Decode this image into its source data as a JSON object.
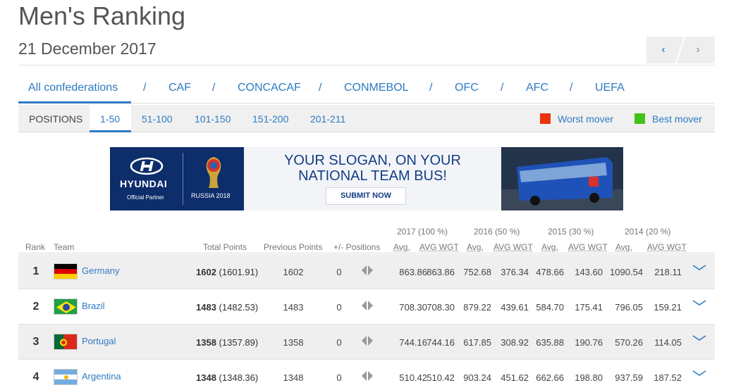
{
  "header": {
    "title": "Men's Ranking",
    "date": "21 December 2017",
    "prev_label": "‹",
    "next_label": "›"
  },
  "confederations": [
    "All confederations",
    "CAF",
    "CONCACAF",
    "CONMEBOL",
    "OFC",
    "AFC",
    "UEFA"
  ],
  "separator": "/",
  "positions": {
    "label": "POSITIONS",
    "ranges": [
      "1-50",
      "51-100",
      "101-150",
      "151-200",
      "201-211"
    ],
    "active": "1-50"
  },
  "legend": {
    "worst_label": "Worst mover",
    "best_label": "Best mover",
    "worst_color": "#e8350d",
    "best_color": "#44c21a"
  },
  "banner": {
    "brand": "HYUNDAI",
    "partner": "Official Partner",
    "event": "RUSSIA 2018",
    "slogan_line1": "YOUR SLOGAN, ON YOUR",
    "slogan_line2": "NATIONAL TEAM BUS!",
    "cta": "SUBMIT NOW"
  },
  "table": {
    "years": [
      "2017 (100 %)",
      "2016 (50 %)",
      "2015 (30 %)",
      "2014 (20 %)"
    ],
    "headers": {
      "rank": "Rank",
      "team": "Team",
      "total": "Total Points",
      "previous": "Previous Points",
      "movement": "+/- Positions",
      "avg": "Avg.",
      "avg_wgt": "AVG WGT"
    },
    "rows": [
      {
        "rank": "1",
        "team": "Germany",
        "flag": "germany-flag",
        "points": "1602",
        "points_exact": "(1601.91)",
        "previous": "1602",
        "movement": "0",
        "stats": [
          "863.86",
          "863.86",
          "752.68",
          "376.34",
          "478.66",
          "143.60",
          "1090.54",
          "218.11"
        ]
      },
      {
        "rank": "2",
        "team": "Brazil",
        "flag": "brazil-flag",
        "points": "1483",
        "points_exact": "(1482.53)",
        "previous": "1483",
        "movement": "0",
        "stats": [
          "708.30",
          "708.30",
          "879.22",
          "439.61",
          "584.70",
          "175.41",
          "796.05",
          "159.21"
        ]
      },
      {
        "rank": "3",
        "team": "Portugal",
        "flag": "portugal-flag",
        "points": "1358",
        "points_exact": "(1357.89)",
        "previous": "1358",
        "movement": "0",
        "stats": [
          "744.16",
          "744.16",
          "617.85",
          "308.92",
          "635.88",
          "190.76",
          "570.26",
          "114.05"
        ]
      },
      {
        "rank": "4",
        "team": "Argentina",
        "flag": "argentina-flag",
        "points": "1348",
        "points_exact": "(1348.36)",
        "previous": "1348",
        "movement": "0",
        "stats": [
          "510.42",
          "510.42",
          "903.24",
          "451.62",
          "662.66",
          "198.80",
          "937.59",
          "187.52"
        ]
      }
    ]
  }
}
